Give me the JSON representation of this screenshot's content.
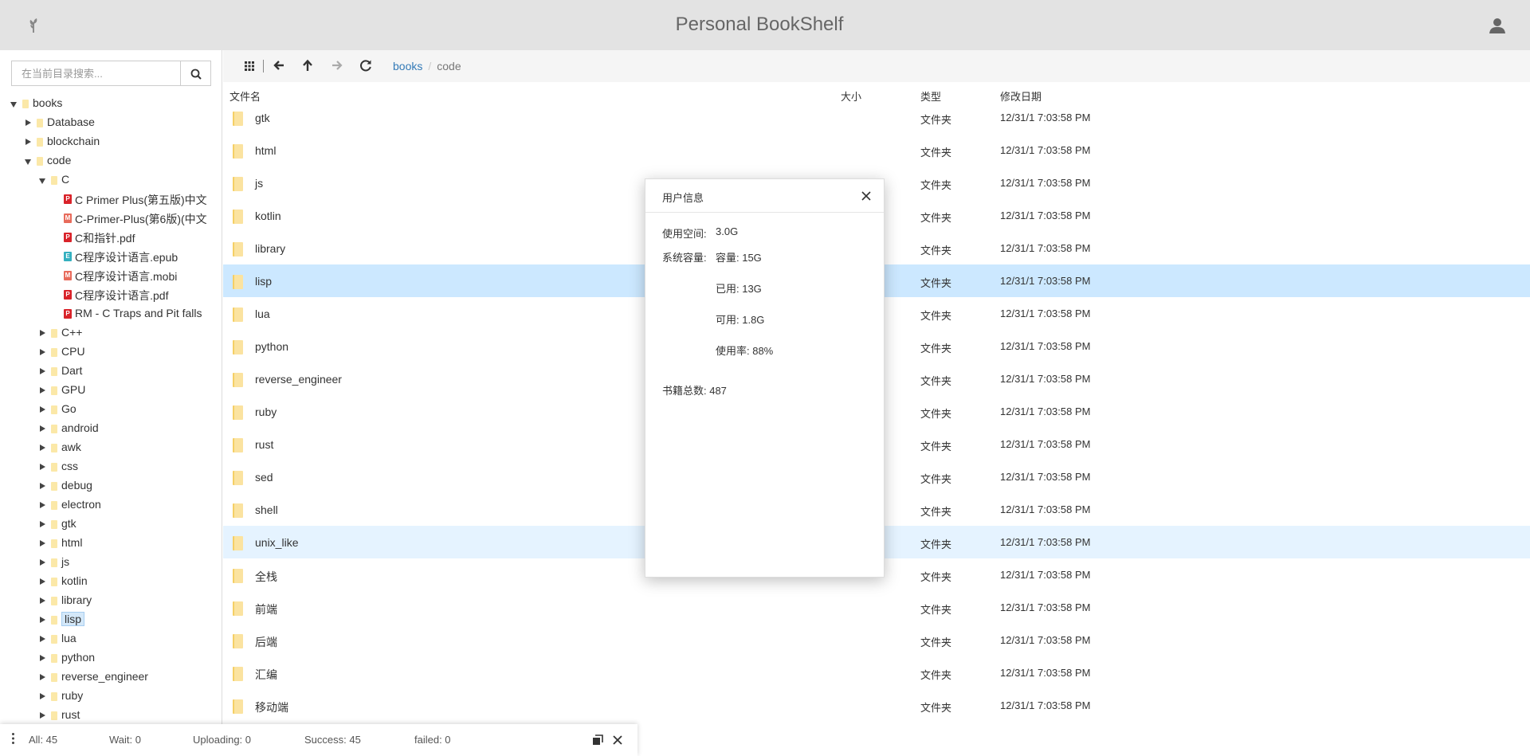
{
  "header": {
    "title": "Personal BookShelf",
    "logo_icon": "sprout-icon",
    "user_icon": "user-icon"
  },
  "search": {
    "placeholder": "在当前目录搜索...",
    "value": ""
  },
  "tree": [
    {
      "label": "books",
      "depth": 0,
      "kind": "folder",
      "state": "open"
    },
    {
      "label": "Database",
      "depth": 1,
      "kind": "folder",
      "state": "closed"
    },
    {
      "label": "blockchain",
      "depth": 1,
      "kind": "folder",
      "state": "closed"
    },
    {
      "label": "code",
      "depth": 1,
      "kind": "folder",
      "state": "open"
    },
    {
      "label": "C",
      "depth": 2,
      "kind": "folder",
      "state": "open"
    },
    {
      "label": "C Primer Plus(第五版)中文",
      "depth": 3,
      "kind": "pdf",
      "state": "leaf"
    },
    {
      "label": "C-Primer-Plus(第6版)(中文",
      "depth": 3,
      "kind": "mobi",
      "state": "leaf"
    },
    {
      "label": "C和指针.pdf",
      "depth": 3,
      "kind": "pdf",
      "state": "leaf"
    },
    {
      "label": "C程序设计语言.epub",
      "depth": 3,
      "kind": "epub",
      "state": "leaf"
    },
    {
      "label": "C程序设计语言.mobi",
      "depth": 3,
      "kind": "mobi",
      "state": "leaf"
    },
    {
      "label": "C程序设计语言.pdf",
      "depth": 3,
      "kind": "pdf",
      "state": "leaf"
    },
    {
      "label": "RM - C Traps and Pit falls",
      "depth": 3,
      "kind": "pdf",
      "state": "leaf"
    },
    {
      "label": "C++",
      "depth": 2,
      "kind": "folder",
      "state": "closed"
    },
    {
      "label": "CPU",
      "depth": 2,
      "kind": "folder",
      "state": "closed"
    },
    {
      "label": "Dart",
      "depth": 2,
      "kind": "folder",
      "state": "closed"
    },
    {
      "label": "GPU",
      "depth": 2,
      "kind": "folder",
      "state": "closed"
    },
    {
      "label": "Go",
      "depth": 2,
      "kind": "folder",
      "state": "closed"
    },
    {
      "label": "android",
      "depth": 2,
      "kind": "folder",
      "state": "closed"
    },
    {
      "label": "awk",
      "depth": 2,
      "kind": "folder",
      "state": "closed"
    },
    {
      "label": "css",
      "depth": 2,
      "kind": "folder",
      "state": "closed"
    },
    {
      "label": "debug",
      "depth": 2,
      "kind": "folder",
      "state": "closed"
    },
    {
      "label": "electron",
      "depth": 2,
      "kind": "folder",
      "state": "closed"
    },
    {
      "label": "gtk",
      "depth": 2,
      "kind": "folder",
      "state": "closed"
    },
    {
      "label": "html",
      "depth": 2,
      "kind": "folder",
      "state": "closed"
    },
    {
      "label": "js",
      "depth": 2,
      "kind": "folder",
      "state": "closed"
    },
    {
      "label": "kotlin",
      "depth": 2,
      "kind": "folder",
      "state": "closed"
    },
    {
      "label": "library",
      "depth": 2,
      "kind": "folder",
      "state": "closed"
    },
    {
      "label": "lisp",
      "depth": 2,
      "kind": "folder",
      "state": "closed",
      "selected": true
    },
    {
      "label": "lua",
      "depth": 2,
      "kind": "folder",
      "state": "closed"
    },
    {
      "label": "python",
      "depth": 2,
      "kind": "folder",
      "state": "closed"
    },
    {
      "label": "reverse_engineer",
      "depth": 2,
      "kind": "folder",
      "state": "closed"
    },
    {
      "label": "ruby",
      "depth": 2,
      "kind": "folder",
      "state": "closed"
    },
    {
      "label": "rust",
      "depth": 2,
      "kind": "folder",
      "state": "closed"
    }
  ],
  "toolbar": {
    "icons": [
      "grid-view-icon",
      "back-arrow-icon",
      "up-arrow-icon",
      "forward-arrow-icon",
      "refresh-icon"
    ],
    "breadcrumb": [
      "books",
      "code"
    ]
  },
  "table": {
    "columns": {
      "name": "文件名",
      "size": "大小",
      "type": "类型",
      "modified": "修改日期"
    },
    "rows": [
      {
        "name": "gtk",
        "type": "文件夹",
        "modified": "12/31/1 7:03:58 PM"
      },
      {
        "name": "html",
        "type": "文件夹",
        "modified": "12/31/1 7:03:58 PM"
      },
      {
        "name": "js",
        "type": "文件夹",
        "modified": "12/31/1 7:03:58 PM"
      },
      {
        "name": "kotlin",
        "type": "文件夹",
        "modified": "12/31/1 7:03:58 PM"
      },
      {
        "name": "library",
        "type": "文件夹",
        "modified": "12/31/1 7:03:58 PM"
      },
      {
        "name": "lisp",
        "type": "文件夹",
        "modified": "12/31/1 7:03:58 PM",
        "highlight": "selected"
      },
      {
        "name": "lua",
        "type": "文件夹",
        "modified": "12/31/1 7:03:58 PM"
      },
      {
        "name": "python",
        "type": "文件夹",
        "modified": "12/31/1 7:03:58 PM"
      },
      {
        "name": "reverse_engineer",
        "type": "文件夹",
        "modified": "12/31/1 7:03:58 PM"
      },
      {
        "name": "ruby",
        "type": "文件夹",
        "modified": "12/31/1 7:03:58 PM"
      },
      {
        "name": "rust",
        "type": "文件夹",
        "modified": "12/31/1 7:03:58 PM"
      },
      {
        "name": "sed",
        "type": "文件夹",
        "modified": "12/31/1 7:03:58 PM"
      },
      {
        "name": "shell",
        "type": "文件夹",
        "modified": "12/31/1 7:03:58 PM"
      },
      {
        "name": "unix_like",
        "type": "文件夹",
        "modified": "12/31/1 7:03:58 PM",
        "highlight": "hover"
      },
      {
        "name": "全栈",
        "type": "文件夹",
        "modified": "12/31/1 7:03:58 PM"
      },
      {
        "name": "前端",
        "type": "文件夹",
        "modified": "12/31/1 7:03:58 PM"
      },
      {
        "name": "后端",
        "type": "文件夹",
        "modified": "12/31/1 7:03:58 PM"
      },
      {
        "name": "汇编",
        "type": "文件夹",
        "modified": "12/31/1 7:03:58 PM"
      },
      {
        "name": "移动端",
        "type": "文件夹",
        "modified": "12/31/1 7:03:58 PM"
      }
    ]
  },
  "modal": {
    "title": "用户信息",
    "used_space_label": "使用空间:",
    "used_space_value": "3.0G",
    "system_capacity_label": "系统容量:",
    "capacity": "容量: 15G",
    "used": "已用: 13G",
    "available": "可用: 1.8G",
    "usage_rate": "使用率: 88%",
    "book_count": "书籍总数: 487"
  },
  "upload": {
    "all": "All: 45",
    "wait": "Wait: 0",
    "uploading": "Uploading: 0",
    "success": "Success: 45",
    "failed": "failed: 0"
  },
  "colors": {
    "header_bg": "#e3e3e3",
    "selected_row": "#cce8ff",
    "hover_row": "#e5f3ff",
    "link": "#337ab7",
    "folder": "#fbe3a0"
  }
}
